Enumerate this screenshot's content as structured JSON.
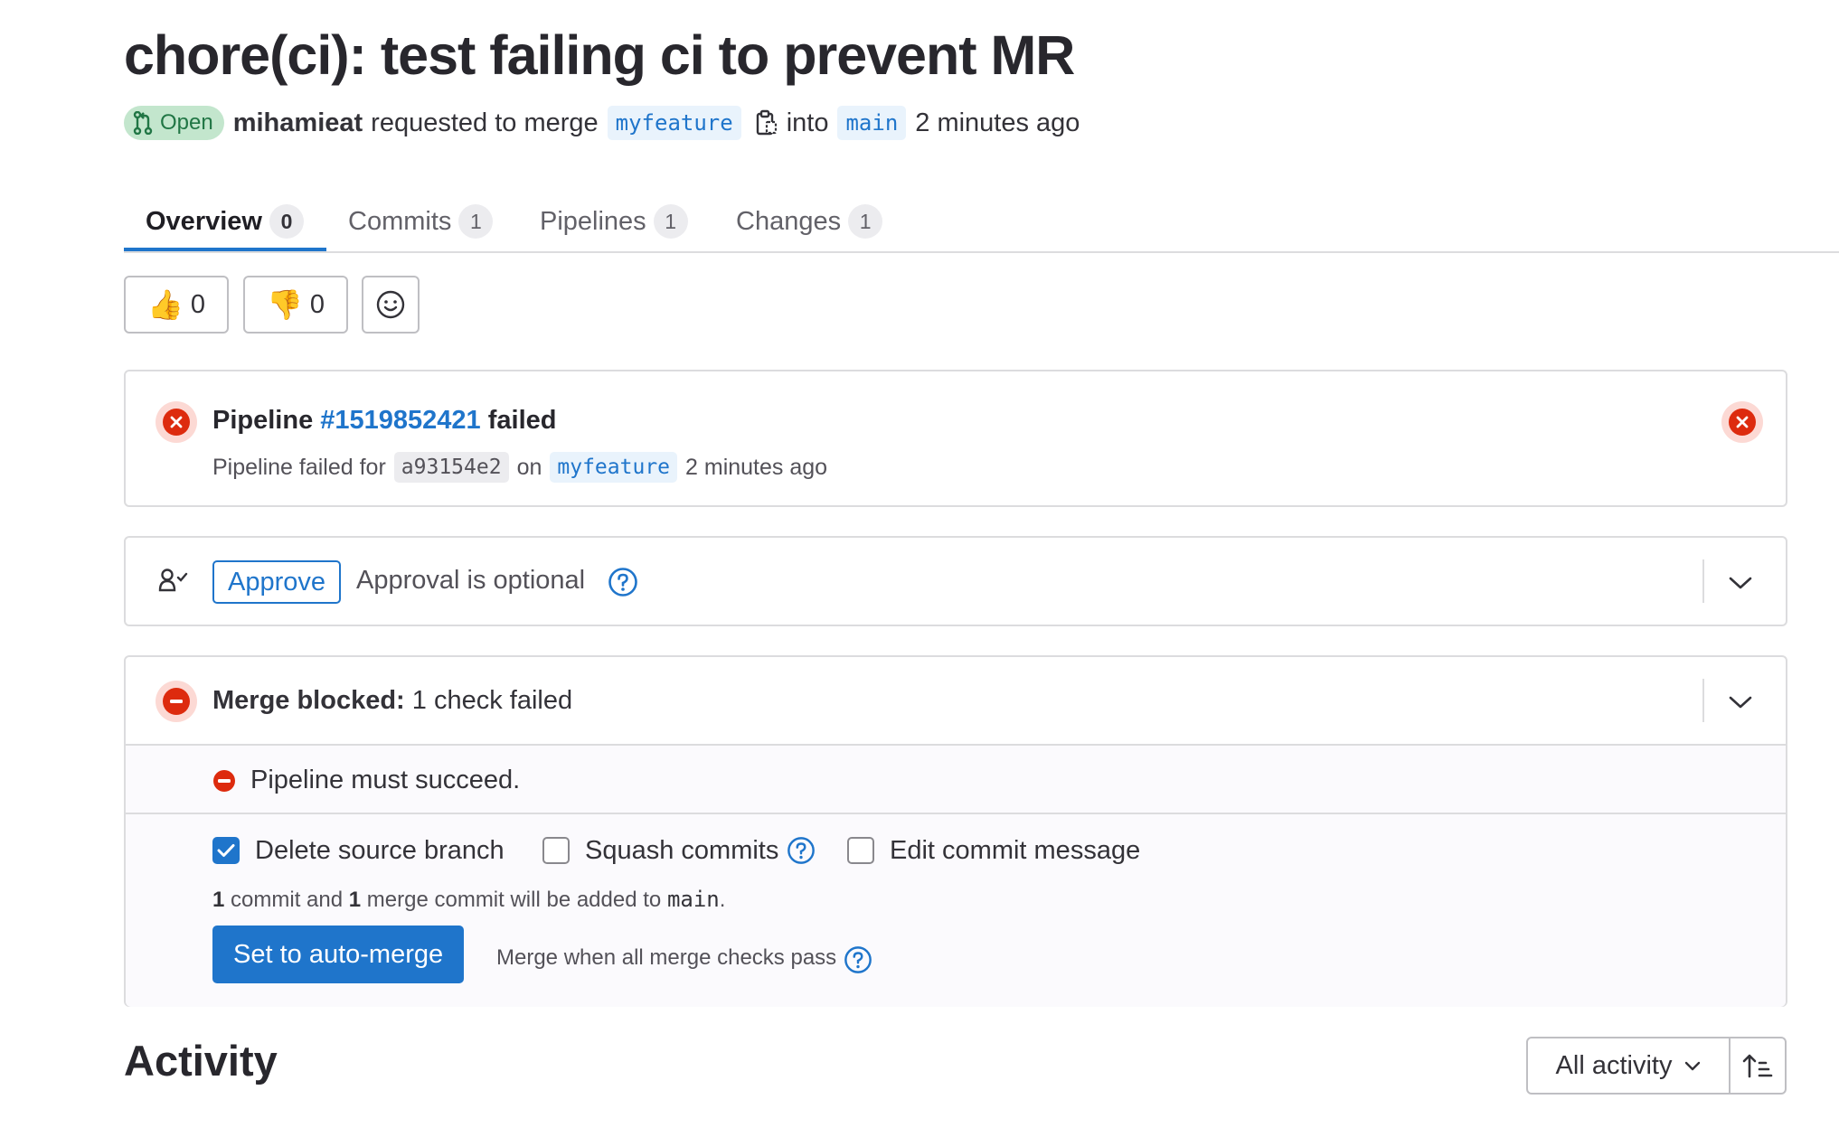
{
  "header": {
    "title": "chore(ci): test failing ci to prevent MR",
    "status_label": "Open",
    "author": "mihamieat",
    "requested_text": "requested to merge",
    "source_branch": "myfeature",
    "into_text": "into",
    "target_branch": "main",
    "time_ago": "2 minutes ago"
  },
  "tabs": [
    {
      "label": "Overview",
      "count": "0",
      "active": true
    },
    {
      "label": "Commits",
      "count": "1"
    },
    {
      "label": "Pipelines",
      "count": "1"
    },
    {
      "label": "Changes",
      "count": "1"
    }
  ],
  "awards": {
    "thumbs_up_count": "0",
    "thumbs_down_count": "0"
  },
  "pipeline": {
    "prefix": "Pipeline",
    "id": "#1519852421",
    "status_word": "failed",
    "failed_for_text": "Pipeline failed for",
    "sha": "a93154e2",
    "on_text": "on",
    "branch": "myfeature",
    "time_ago": "2 minutes ago"
  },
  "approval": {
    "button_label": "Approve",
    "status_text": "Approval is optional"
  },
  "merge": {
    "blocked_label": "Merge blocked:",
    "blocked_detail": "1 check failed",
    "check_text": "Pipeline must succeed.",
    "options": {
      "delete_source_branch": {
        "label": "Delete source branch",
        "checked": true
      },
      "squash_commits": {
        "label": "Squash commits",
        "checked": false
      },
      "edit_commit_message": {
        "label": "Edit commit message",
        "checked": false
      }
    },
    "commit_note": {
      "count1": "1",
      "text1": "commit and",
      "count2": "1",
      "text2": "merge commit will be added to",
      "branch": "main",
      "suffix": "."
    },
    "automerge_button": "Set to auto-merge",
    "merge_when_text": "Merge when all merge checks pass"
  },
  "activity": {
    "title": "Activity",
    "filter_label": "All activity"
  },
  "colors": {
    "accent": "#1f75cb",
    "danger": "#dd2b0e",
    "open_bg": "#c3e6cd",
    "open_text": "#217645"
  }
}
